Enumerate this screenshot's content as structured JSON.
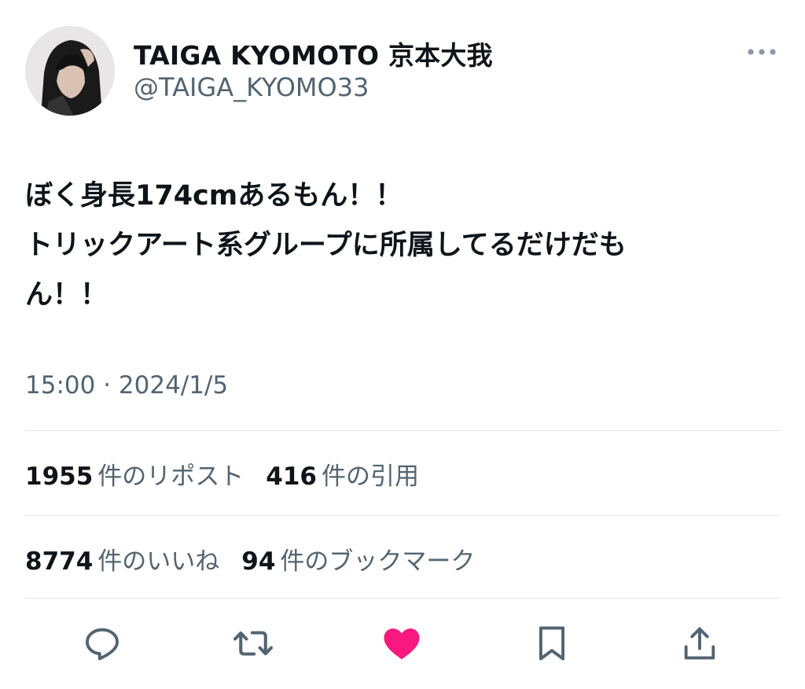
{
  "user": {
    "display_name": "TAIGA KYOMOTO 京本大我",
    "handle": "@TAIGA_KYOMO33"
  },
  "tweet": {
    "lines": [
      "ぼく身長174cmあるもん！！",
      "トリックアート系グループに所属してるだけだも",
      "ん！！"
    ],
    "timestamp": "15:00 · 2024/1/5"
  },
  "stats": {
    "reposts": {
      "count": "1955",
      "label": "件のリポスト"
    },
    "quotes": {
      "count": "416",
      "label": "件の引用"
    },
    "likes": {
      "count": "8774",
      "label": "件のいいね"
    },
    "bookmarks": {
      "count": "94",
      "label": "件のブックマーク"
    }
  },
  "actions": {
    "icons": [
      "reply-icon",
      "repost-icon",
      "like-icon",
      "bookmark-icon",
      "share-icon"
    ],
    "like_active": true,
    "like_color": "#f91880",
    "icon_color": "#536471"
  }
}
